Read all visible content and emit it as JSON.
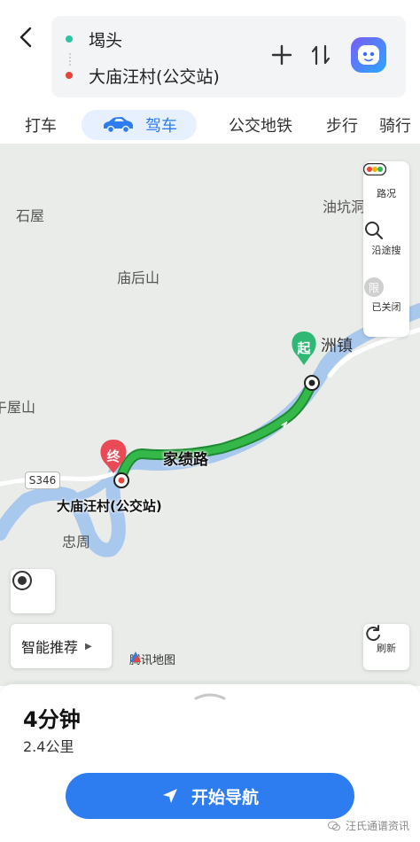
{
  "route": {
    "start": "堨头",
    "end": "大庙汪村(公交站)"
  },
  "tabs": [
    {
      "label": "打车"
    },
    {
      "label": "驾车"
    },
    {
      "label": "公交地铁"
    },
    {
      "label": "步行"
    },
    {
      "label": "骑行"
    }
  ],
  "map": {
    "places": {
      "shiwu": "石屋",
      "youkeng": "油坑洞",
      "miaohoushan": "庙后山",
      "zhouzhen": "洲镇",
      "wushan": "午屋山",
      "zhongzhou": "忠周"
    },
    "road_label": "家绩路",
    "road_badge": "S346",
    "start_marker": "起",
    "end_marker": "终",
    "end_stop_label": "大庙汪村(公交站)",
    "tools": {
      "traffic": "路况",
      "search_along": "沿途搜",
      "limit": "已关闭",
      "limit_icon_text": "限"
    },
    "smart_recommend": "智能推荐",
    "refresh": "刷新",
    "logo": "腾讯地图"
  },
  "summary": {
    "duration": "4分钟",
    "distance": "2.4公里",
    "start_nav": "开始导航"
  },
  "watermark": "汪氏通谱资讯",
  "colors": {
    "accent": "#2d7cf0",
    "route": "#35b84a",
    "water": "#a9c8ee",
    "start": "#2ec4a0",
    "end": "#e8443a"
  }
}
